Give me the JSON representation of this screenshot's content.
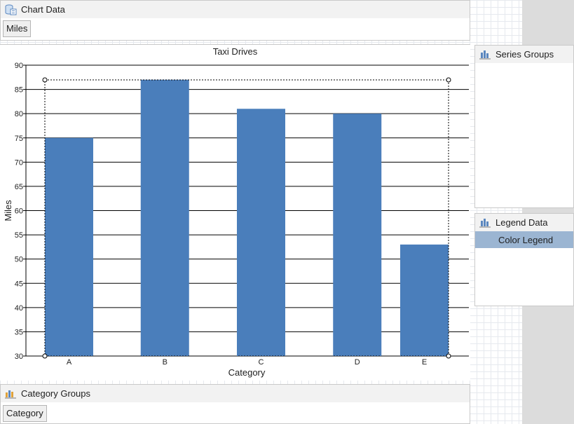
{
  "chart_data_panel": {
    "title": "Chart Data",
    "value_tag": "Miles"
  },
  "series_groups_panel": {
    "title": "Series Groups"
  },
  "legend_data_panel": {
    "title": "Legend Data",
    "items": [
      "Color Legend"
    ]
  },
  "category_groups_panel": {
    "title": "Category Groups",
    "group_tag": "Category"
  },
  "colors": {
    "bar": "#4a7ebb",
    "selected_legend": "#9bb5d2"
  },
  "chart_data": {
    "type": "bar",
    "title": "Taxi Drives",
    "xlabel": "Category",
    "ylabel": "Miles",
    "categories": [
      "A",
      "B",
      "C",
      "D",
      "E"
    ],
    "values": [
      75,
      87,
      81,
      80,
      53
    ],
    "ylim": [
      30,
      90
    ],
    "yticks": [
      30,
      35,
      40,
      45,
      50,
      55,
      60,
      65,
      70,
      75,
      80,
      85,
      90
    ],
    "grid": true
  }
}
